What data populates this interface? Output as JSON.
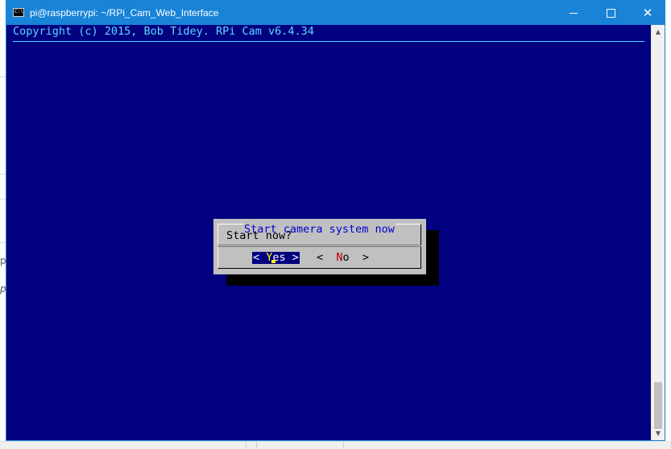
{
  "window": {
    "title": "pi@raspberrypi: ~/RPi_Cam_Web_Interface",
    "icon": "console-icon",
    "icon_glyph": "C:\\",
    "controls": {
      "minimize": "minimize-icon",
      "maximize": "maximize-icon",
      "close": "close-icon",
      "close_glyph": "✕"
    },
    "colors": {
      "titlebar": "#1883d7",
      "console_bg": "#000080",
      "text_cyan": "#5fd7ff",
      "dialog_bg": "#c0c0c0"
    }
  },
  "console": {
    "backtitle": "Copyright (c) 2015, Bob Tidey. RPi Cam v6.4.34"
  },
  "dialog": {
    "title": "Start camera system now",
    "message": "Start now?",
    "yes_button": {
      "left": "< ",
      "hotkey": "Y",
      "rest": "es",
      "right": " >"
    },
    "no_button": {
      "left": "<  ",
      "hotkey": "N",
      "rest": "o",
      "right": "  >"
    }
  },
  "background_app": {
    "fragments": [
      "p",
      "p"
    ]
  }
}
